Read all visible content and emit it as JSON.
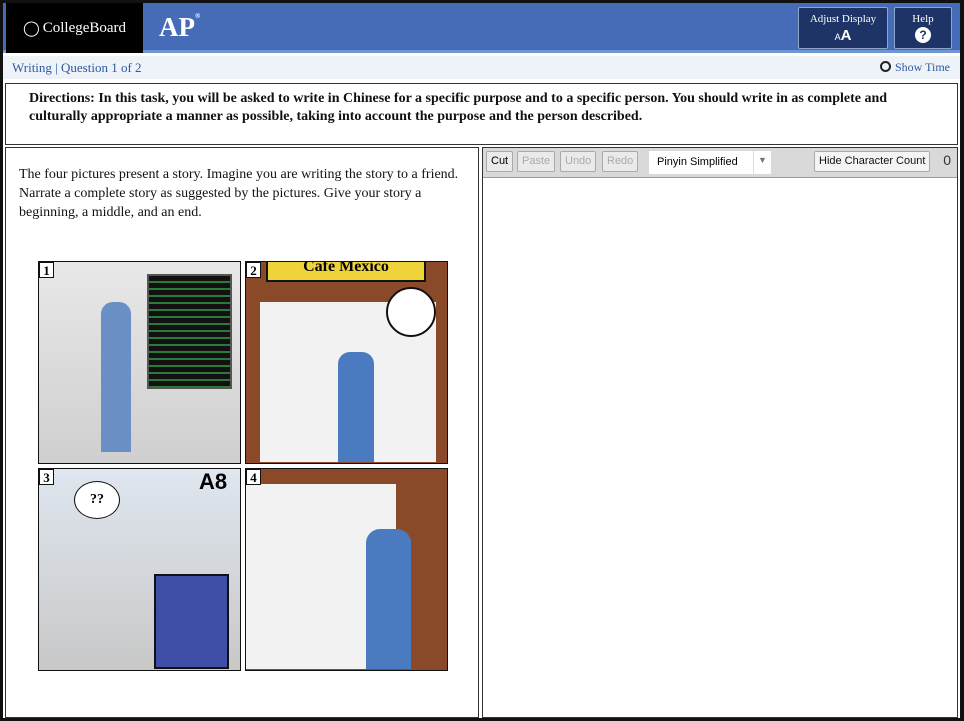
{
  "header": {
    "logo": "CollegeBoard",
    "program": "AP",
    "adjust_display": "Adjust Display",
    "adjust_icon": "AA",
    "help": "Help",
    "help_icon": "?"
  },
  "subheader": {
    "section": "Writing | Question 1 of 2",
    "show_time": "Show Time"
  },
  "directions": "Directions: In this task, you will be asked to write in Chinese for a specific purpose and to a specific person. You should write in as complete and culturally appropriate a manner as possible, taking into account the purpose and the person described.",
  "prompt": "The four pictures present a story.  Imagine you are writing the story to a friend.  Narrate a complete story as suggested by the pictures.  Give your story a beginning, a middle, and an end.",
  "comic": {
    "panels": [
      {
        "number": "1"
      },
      {
        "number": "2",
        "sign": "Cafe Mexico"
      },
      {
        "number": "3",
        "sign": "A8",
        "thought": "??"
      },
      {
        "number": "4"
      }
    ]
  },
  "toolbar": {
    "cut": "Cut",
    "paste": "Paste",
    "undo": "Undo",
    "redo": "Redo",
    "input_method": "Pinyin Simplified",
    "hide_count": "Hide Character Count",
    "char_count": "0"
  },
  "colors": {
    "header": "#466cb7",
    "logo_bg": "#000000",
    "button": "#1f3466"
  }
}
